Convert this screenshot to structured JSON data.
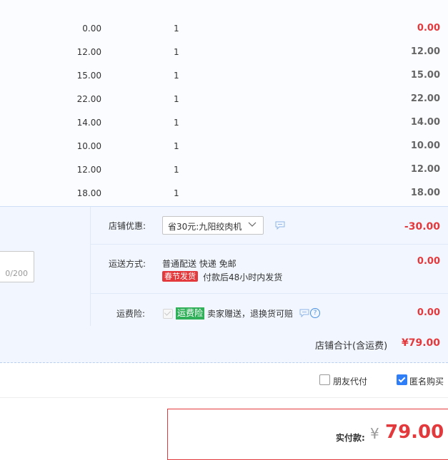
{
  "items": [
    {
      "price": "0.00",
      "qty": "1",
      "subtotal": "0.00"
    },
    {
      "price": "12.00",
      "qty": "1",
      "subtotal": "12.00"
    },
    {
      "price": "15.00",
      "qty": "1",
      "subtotal": "15.00"
    },
    {
      "price": "22.00",
      "qty": "1",
      "subtotal": "22.00"
    },
    {
      "price": "14.00",
      "qty": "1",
      "subtotal": "14.00"
    },
    {
      "price": "10.00",
      "qty": "1",
      "subtotal": "10.00"
    },
    {
      "price": "12.00",
      "qty": "1",
      "subtotal": "12.00"
    },
    {
      "price": "18.00",
      "qty": "1",
      "subtotal": "18.00"
    }
  ],
  "memo": {
    "count": "0/200"
  },
  "discount": {
    "label": "店铺优惠:",
    "selected": "省30元:九阳绞肉机",
    "value": "-30.00"
  },
  "shipping": {
    "label": "运送方式:",
    "method": "普通配送 快递 免邮",
    "tag": "春节发货",
    "note": "付款后48小时内发货",
    "value": "0.00"
  },
  "insurance": {
    "label": "运费险:",
    "tag": "运费险",
    "text": "卖家赠送，退换货可赔",
    "value": "0.00",
    "help": "?"
  },
  "store_total": {
    "label": "店铺合计(含运费)",
    "amount": "¥79.00"
  },
  "options": {
    "friend_pay": "朋友代付",
    "anonymous": "匿名购买"
  },
  "payment": {
    "label": "实付款:",
    "currency": "¥",
    "amount": "79.00"
  },
  "colors": {
    "accent": "#e4393c",
    "panel": "#f2f7ff",
    "checkbox": "#2f7ef7",
    "insurance_tag": "#31b05a"
  }
}
